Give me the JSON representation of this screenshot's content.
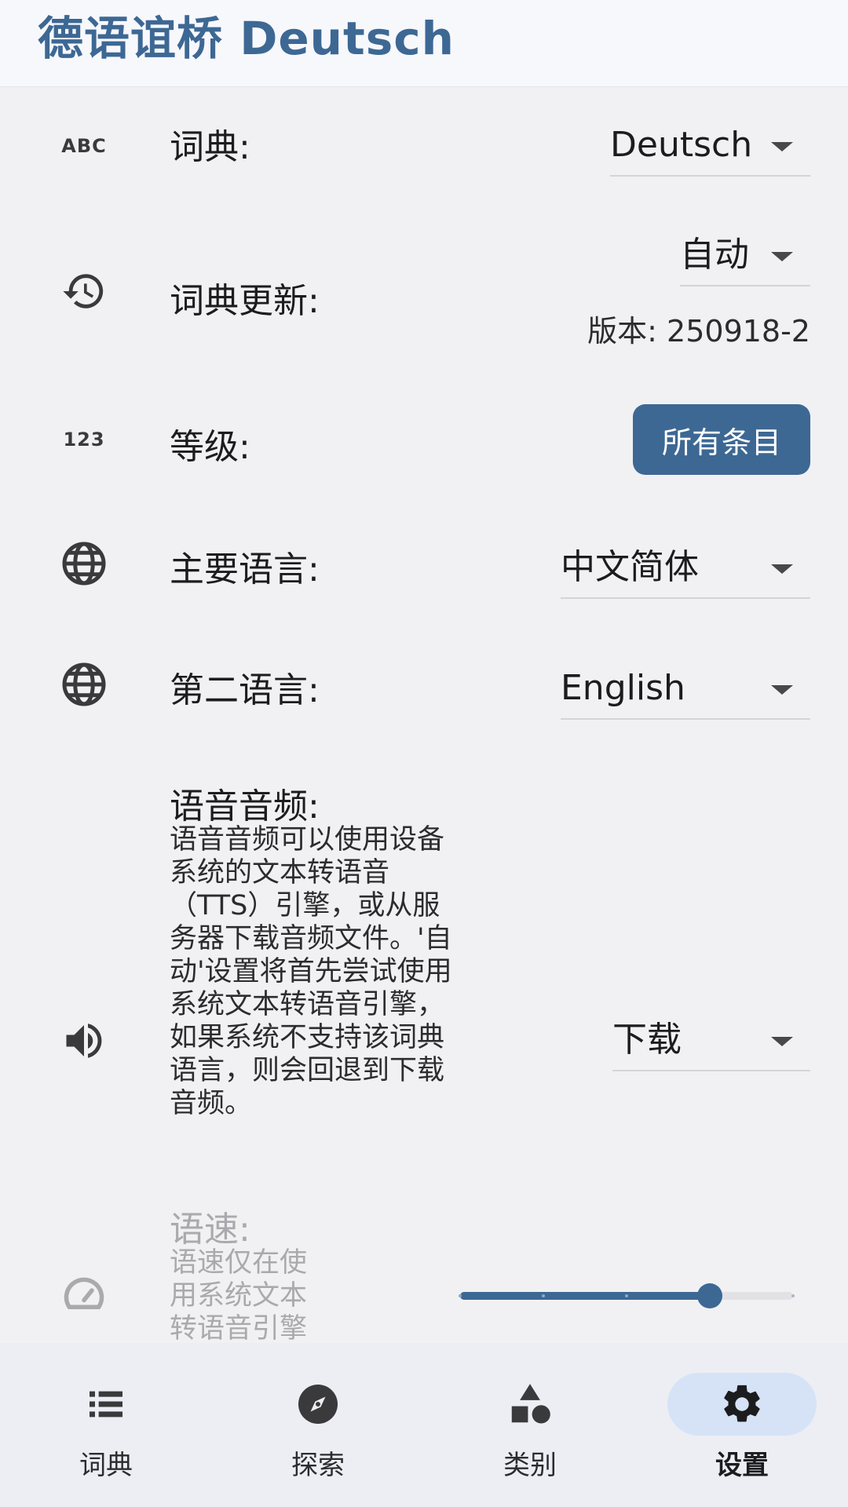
{
  "app": {
    "title": "德语谊桥  Deutsch"
  },
  "settings": {
    "dictionary": {
      "icon": "abc-icon",
      "icon_text": "ABC",
      "label": "词典:",
      "value": "Deutsch"
    },
    "dictionary_update": {
      "icon": "update-history-icon",
      "label": "词典更新:",
      "value": "自动",
      "version": "版本: 250918-2"
    },
    "level": {
      "icon": "numbers-icon",
      "icon_text": "123",
      "label": "等级:",
      "button": "所有条目"
    },
    "primary_language": {
      "icon": "globe-icon",
      "label": "主要语言:",
      "value": "中文简体"
    },
    "secondary_language": {
      "icon": "globe-icon",
      "label": "第二语言:",
      "value": "English"
    },
    "voice_audio": {
      "icon": "speaker-icon",
      "label": "语音音频:",
      "description": [
        "语音音频可以使用设备",
        "系统的文本转语音",
        "（TTS）引擎，或从服",
        "务器下载音频文件。'自",
        "动'设置将首先尝试使用",
        "系统文本转语音引擎，",
        "如果系统不支持该词典",
        "语言，则会回退到下载",
        "音频。"
      ],
      "value": "下载"
    },
    "speech_rate": {
      "icon": "speedometer-icon",
      "label": "语速:",
      "description": [
        "语速仅在使",
        "用系统文本",
        "转语音引擎"
      ],
      "slider_fraction": 0.75,
      "slider_steps": 4,
      "disabled": true
    }
  },
  "bottom_nav": [
    {
      "label": "词典",
      "icon": "list-icon",
      "active": false
    },
    {
      "label": "探索",
      "icon": "compass-icon",
      "active": false
    },
    {
      "label": "类别",
      "icon": "shapes-icon",
      "active": false
    },
    {
      "label": "设置",
      "icon": "gear-icon",
      "active": true
    }
  ],
  "colors": {
    "accent": "#3d6894",
    "active_nav_bg": "#d6e3f6",
    "disabled_text": "#a9a9ae"
  }
}
